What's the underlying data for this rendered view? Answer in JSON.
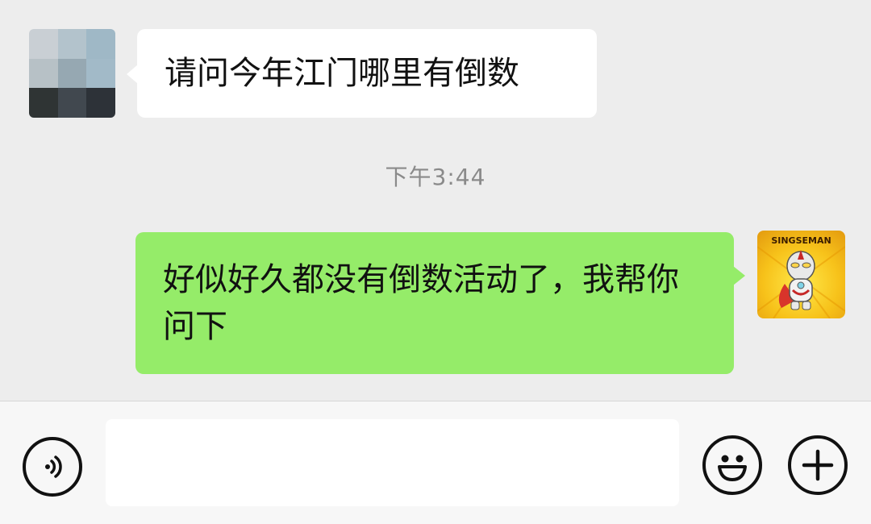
{
  "chat": {
    "incoming_message": "请问今年江门哪里有倒数",
    "timestamp": "下午3:44",
    "outgoing_message": "好似好久都没有倒数活动了，我帮你问下",
    "outgoing_avatar_text": "SINGSEMAN"
  },
  "input_bar": {
    "voice_icon": "voice-icon",
    "emoji_icon": "emoji-icon",
    "plus_icon": "plus-icon",
    "input_value": ""
  },
  "colors": {
    "background": "#ededed",
    "incoming_bubble": "#ffffff",
    "outgoing_bubble": "#95ec69",
    "timestamp": "#8a8a8a"
  }
}
